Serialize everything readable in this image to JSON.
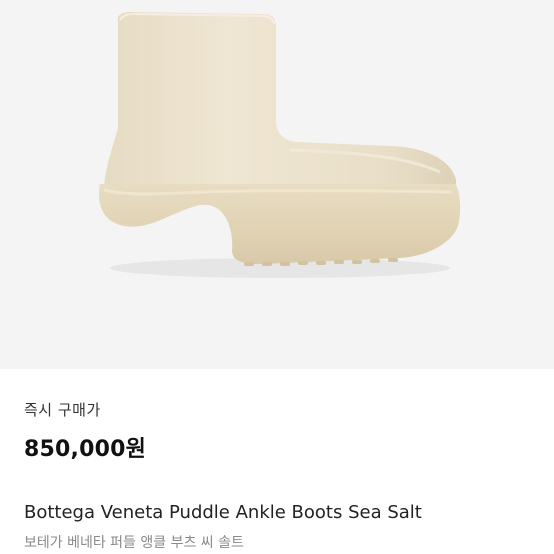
{
  "product": {
    "image_icon": "ankle-boot-image",
    "image_background": "#f4f4f4",
    "boot_color": "#ebe1cc",
    "purchase_label": "즉시 구매가",
    "price": "850,000원",
    "name_en": "Bottega Veneta Puddle Ankle Boots Sea Salt",
    "name_ko": "보테가 베네타 퍼들 앵클 부츠 씨 솔트"
  }
}
